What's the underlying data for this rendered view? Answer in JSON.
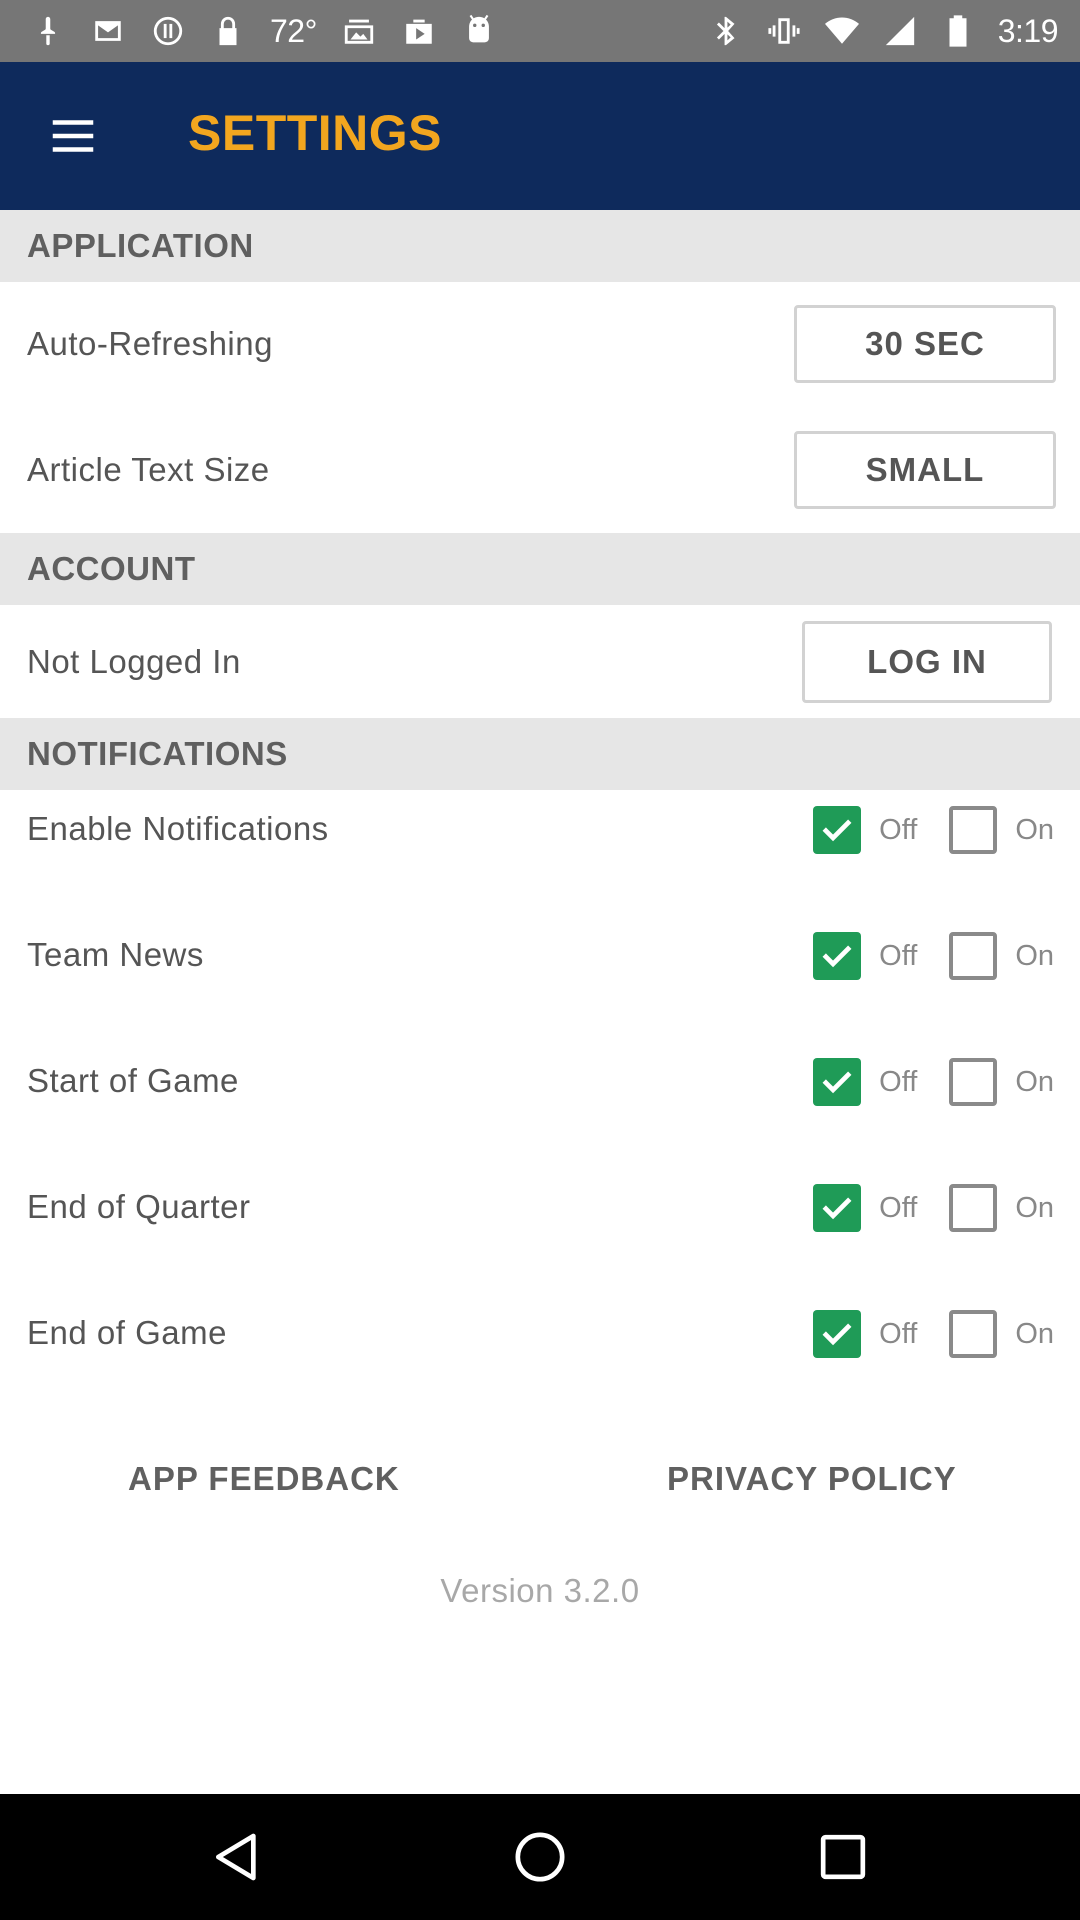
{
  "status_bar": {
    "temperature": "72°",
    "time": "3:19",
    "left_icons": [
      "notification-icon",
      "mail-icon",
      "alert-icon",
      "lock-icon",
      "photos-icon",
      "play-store-icon",
      "android-icon"
    ],
    "right_icons": [
      "bluetooth-icon",
      "vibrate-icon",
      "wifi-icon",
      "signal-icon",
      "battery-icon"
    ]
  },
  "app_bar": {
    "title": "SETTINGS",
    "menu_icon": "hamburger-menu-icon"
  },
  "sections": {
    "application": {
      "header": "APPLICATION",
      "auto_refresh_label": "Auto-Refreshing",
      "auto_refresh_value": "30 SEC",
      "text_size_label": "Article Text Size",
      "text_size_value": "SMALL"
    },
    "account": {
      "header": "ACCOUNT",
      "status_label": "Not Logged In",
      "login_button": "LOG IN"
    },
    "notifications": {
      "header": "NOTIFICATIONS",
      "off_label": "Off",
      "on_label": "On",
      "items": [
        {
          "label": "Enable Notifications",
          "off_checked": true,
          "on_checked": false
        },
        {
          "label": "Team News",
          "off_checked": true,
          "on_checked": false
        },
        {
          "label": "Start of Game",
          "off_checked": true,
          "on_checked": false
        },
        {
          "label": "End of Quarter",
          "off_checked": true,
          "on_checked": false
        },
        {
          "label": "End of Game",
          "off_checked": true,
          "on_checked": false
        }
      ]
    }
  },
  "footer": {
    "feedback_link": "APP FEEDBACK",
    "privacy_link": "PRIVACY POLICY",
    "version": "Version 3.2.0"
  },
  "nav_bar": {
    "icons": [
      "back-icon",
      "home-icon",
      "recents-icon"
    ]
  },
  "colors": {
    "app_bar_bg": "#0e2a5c",
    "title_color": "#f2a61f",
    "checkbox_checked": "#1f9b57",
    "section_bg": "#e6e6e6"
  }
}
